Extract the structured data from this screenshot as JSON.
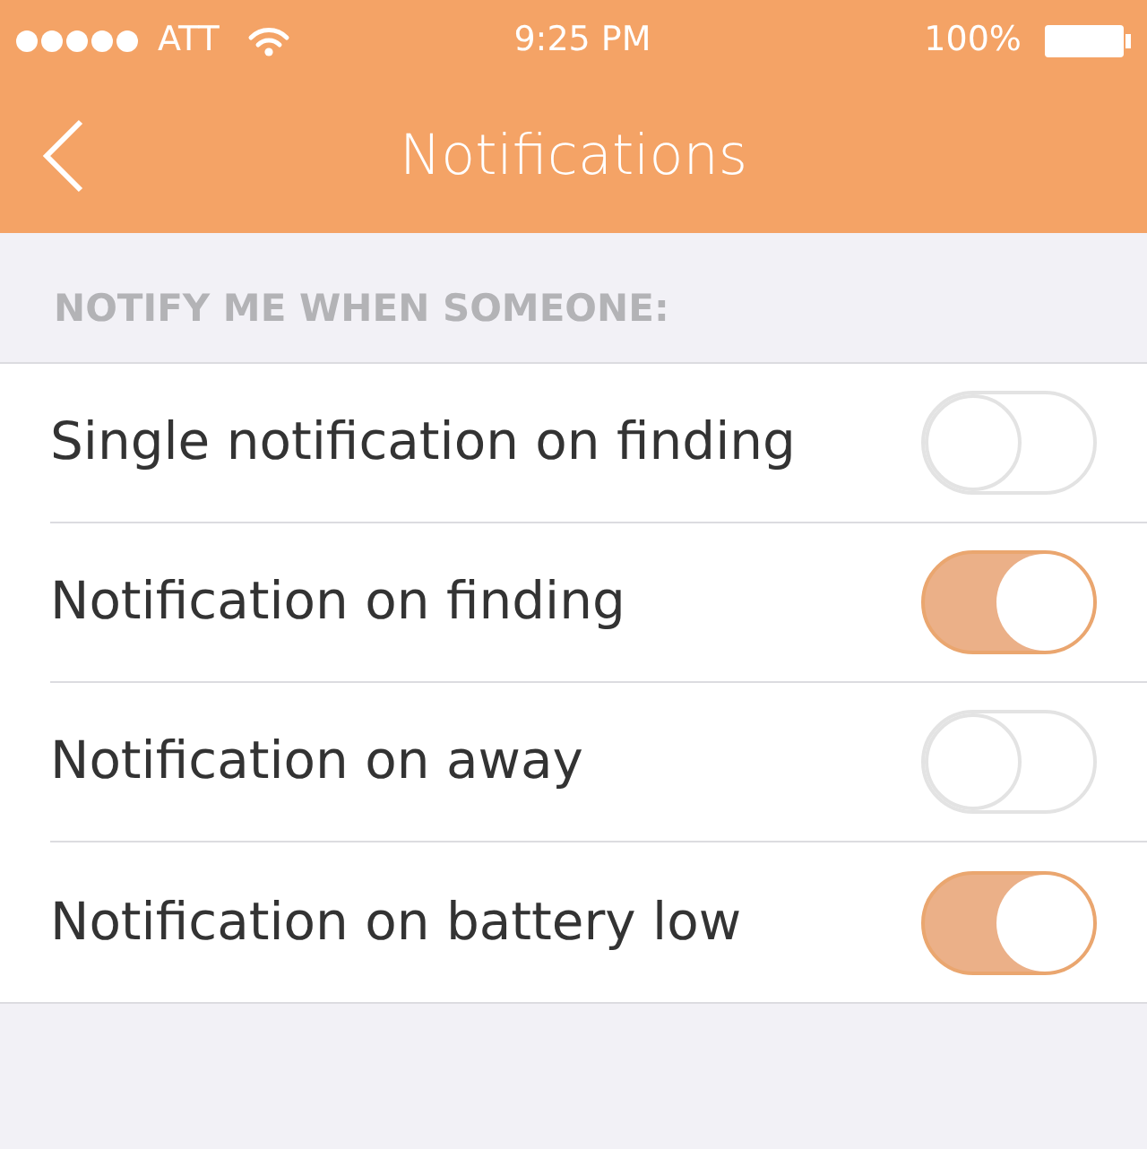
{
  "status_bar": {
    "carrier": "ATT",
    "time": "9:25 PM",
    "battery": "100%"
  },
  "nav_bar": {
    "title": "Notifications"
  },
  "section": {
    "header": "NOTIFY ME WHEN SOMEONE:"
  },
  "settings": [
    {
      "label": "Single notification on finding",
      "on": false
    },
    {
      "label": "Notification on finding",
      "on": true
    },
    {
      "label": "Notification on away",
      "on": false
    },
    {
      "label": "Notification on battery low",
      "on": true
    }
  ]
}
